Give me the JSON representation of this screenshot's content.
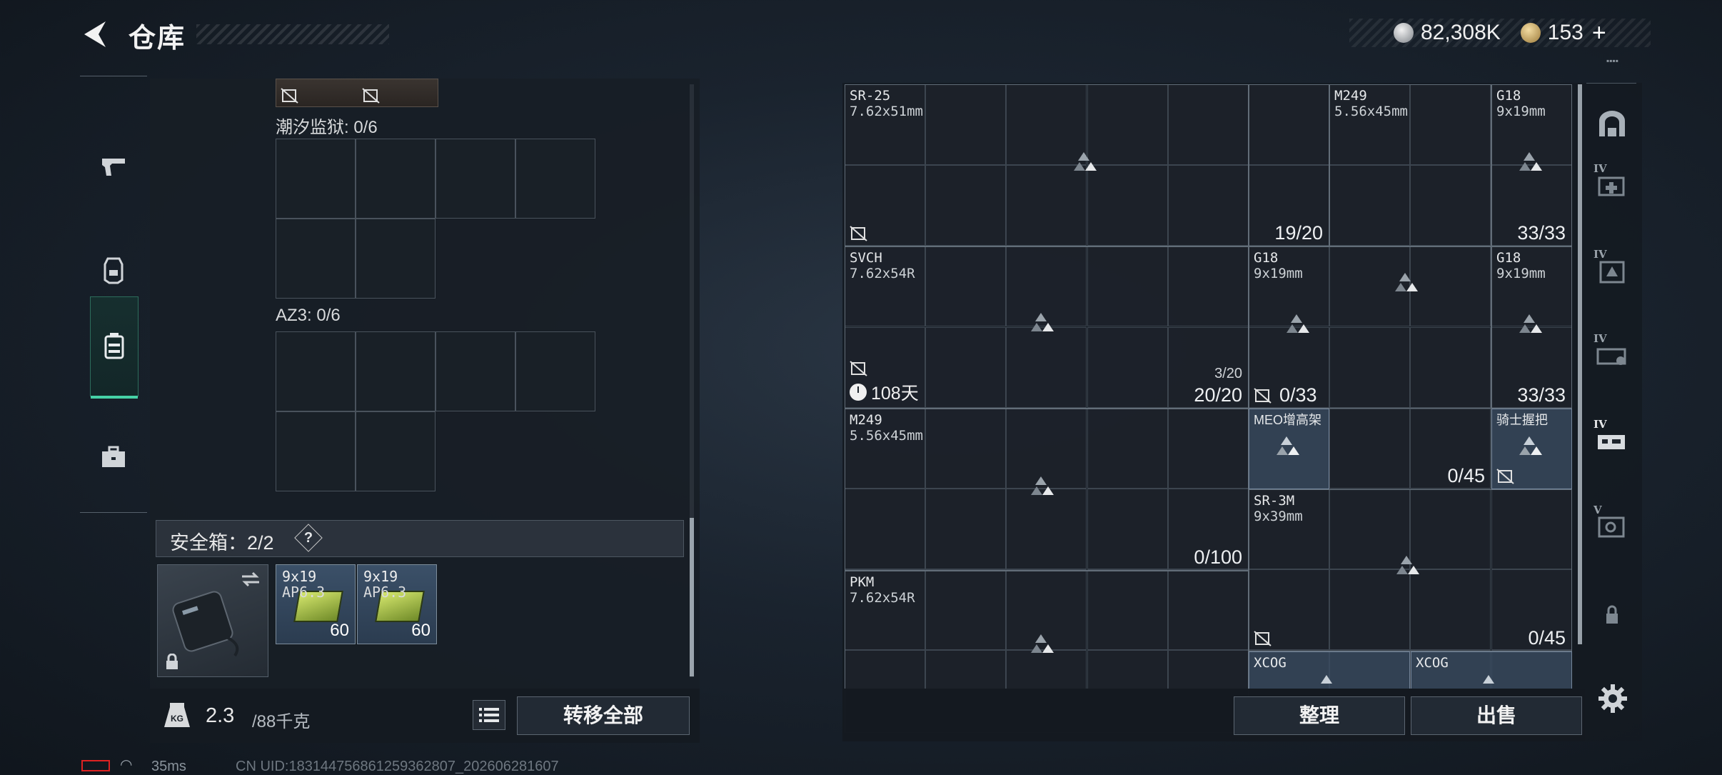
{
  "header": {
    "title": "仓库",
    "silver_amount": "82,308K",
    "gold_amount": "153",
    "plus": "+"
  },
  "left_tabs": [
    {
      "icon": "pistol-icon"
    },
    {
      "icon": "armor-vest-icon"
    },
    {
      "icon": "backpack-icon",
      "active": true
    },
    {
      "icon": "toolbox-icon"
    }
  ],
  "left_panel": {
    "containers": [
      {
        "label": "潮汐监狱: 0/6"
      },
      {
        "label": "AZ3: 0/6"
      }
    ],
    "safe_box": {
      "label": "安全箱：2/2",
      "help": "?",
      "items": [
        {
          "caliber": "9x19",
          "name": "AP6.3",
          "qty": "60"
        },
        {
          "caliber": "9x19",
          "name": "AP6.3",
          "qty": "60"
        }
      ]
    },
    "weight": {
      "current": "2.3",
      "max": "/88千克",
      "icon_text": "KG"
    },
    "transfer_all": "转移全部"
  },
  "right_panel": {
    "items": [
      {
        "name": "SR-25",
        "caliber": "7.62x51mm",
        "count": ""
      },
      {
        "name": "",
        "caliber": "",
        "count": "19/20"
      },
      {
        "name": "M249",
        "caliber": "5.56x45mm",
        "count": ""
      },
      {
        "name": "G18",
        "caliber": "9x19mm",
        "count": "33/33"
      },
      {
        "name": "SVCH",
        "caliber": "7.62x54R",
        "count": "20/20",
        "sub": "3/20",
        "days": "108天"
      },
      {
        "name": "G18",
        "caliber": "9x19mm",
        "count": "0/33"
      },
      {
        "name": "G18",
        "caliber": "9x19mm",
        "count": "33/33"
      },
      {
        "name": "M249",
        "caliber": "5.56x45mm",
        "count": "0/100"
      },
      {
        "name": "MEO增高架",
        "caliber": "",
        "count": ""
      },
      {
        "name": "骑士握把",
        "caliber": "",
        "count": "0/45"
      },
      {
        "name": "SR-3M",
        "caliber": "9x39mm",
        "count": "0/45"
      },
      {
        "name": "PKM",
        "caliber": "7.62x54R",
        "count": ""
      },
      {
        "name": "XCOG",
        "caliber": "",
        "count": ""
      },
      {
        "name": "XCOG",
        "caliber": "",
        "count": ""
      }
    ],
    "sort": "整理",
    "sell": "出售"
  },
  "right_tabs": [
    {
      "icon": "vault-icon",
      "level": ""
    },
    {
      "icon": "medical-case-icon",
      "level": "IV"
    },
    {
      "icon": "weapon-case-icon",
      "level": "IV"
    },
    {
      "icon": "ammo-case-icon",
      "level": "IV"
    },
    {
      "icon": "tool-case-icon",
      "level": "IV"
    },
    {
      "icon": "safe-box-icon",
      "level": "V"
    },
    {
      "icon": "locked-icon",
      "level": ""
    }
  ],
  "status": {
    "ping": "35ms",
    "uid": "CN UID:1831447568612593628​07_202606281607"
  },
  "colors": {
    "accent": "#46d2a6",
    "battery_low": "#dd2222",
    "item_blue": "#3a4c62"
  }
}
